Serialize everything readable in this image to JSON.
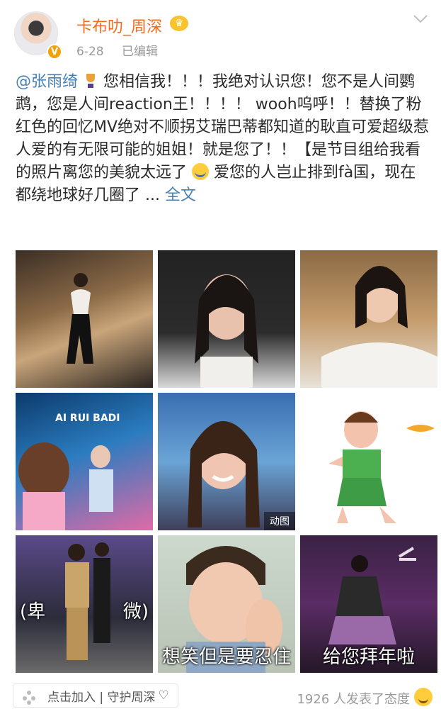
{
  "header": {
    "username": "卡布叻_周深",
    "date": "6-28",
    "edited": "已编辑"
  },
  "post": {
    "mention": "@张雨绮",
    "text_1": " 您相信我！！！我绝对认识您！您不是人间鹦鹉，您是人间reaction王！！！！ wooh呜呼！！替换了粉红色的回忆MV绝对不顺拐艾瑞巴蒂都知道的耿直可爱超级惹人爱的有无限可能的姐姐！就是您了！！【是节目组给我看的照片离您的美貌太远了",
    "text_2": "爱您的人岂止排到fà国，现在都绕地球好几圈了 ... ",
    "full_text": "全文"
  },
  "images": [
    {
      "badge": "",
      "caption": ""
    },
    {
      "badge": "",
      "caption": ""
    },
    {
      "badge": "",
      "caption": ""
    },
    {
      "badge": "",
      "caption": ""
    },
    {
      "badge": "动图",
      "caption": ""
    },
    {
      "badge": "",
      "caption": ""
    },
    {
      "badge": "",
      "caption_left": "(卑",
      "caption_right": "微)"
    },
    {
      "badge": "",
      "caption": "想笑但是要忍住"
    },
    {
      "badge": "",
      "caption": "给您拜年啦"
    }
  ],
  "footer": {
    "join_label": "点击加入 | 守护周深",
    "attitude": "1926 人发表了态度"
  },
  "colors": {
    "username": "#f86a1a",
    "link": "#4a7fb3",
    "verified": "#f2a10b"
  }
}
